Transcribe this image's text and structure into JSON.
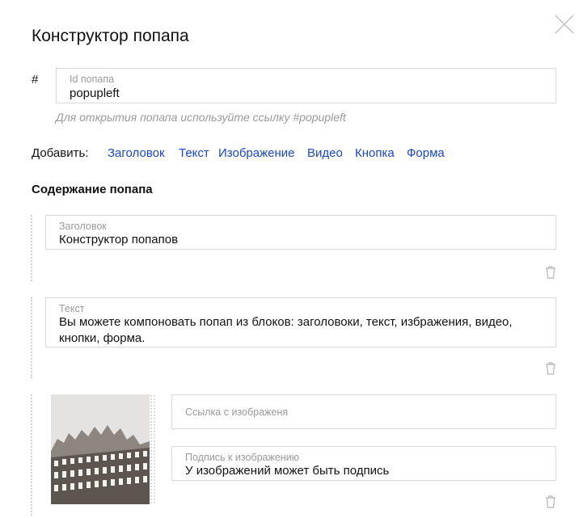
{
  "header": {
    "title": "Конструктор попапа"
  },
  "id_field": {
    "hash": "#",
    "label": "Id попапа",
    "value": "popupleft"
  },
  "hint": "Для открытия попапа используйте ссылку #popupleft",
  "add": {
    "label": "Добавить:",
    "links": [
      "Заголовок",
      "Текст",
      "Изображение",
      "Видео",
      "Кнопка",
      "Форма"
    ]
  },
  "content": {
    "section_title": "Содержание попапа",
    "blocks": [
      {
        "label": "Заголовок",
        "value": "Конструктор попапов"
      },
      {
        "label": "Текст",
        "value_line1": "Вы можете компоновать попап из блоков: заголовоки, текст, избражения, видео,",
        "value_line2": "кнопки, форма."
      },
      {
        "link_placeholder": "Ссылка с изображеня",
        "caption_label": "Подпись к изображению",
        "caption_value": "У изображений может быть подпись"
      }
    ]
  },
  "icons": {
    "close": "close-icon",
    "trash": "trash-icon",
    "image": "building-photo"
  },
  "colors": {
    "link": "#1a47c2",
    "border": "#d9d9d9",
    "muted": "#9a9a9a"
  }
}
